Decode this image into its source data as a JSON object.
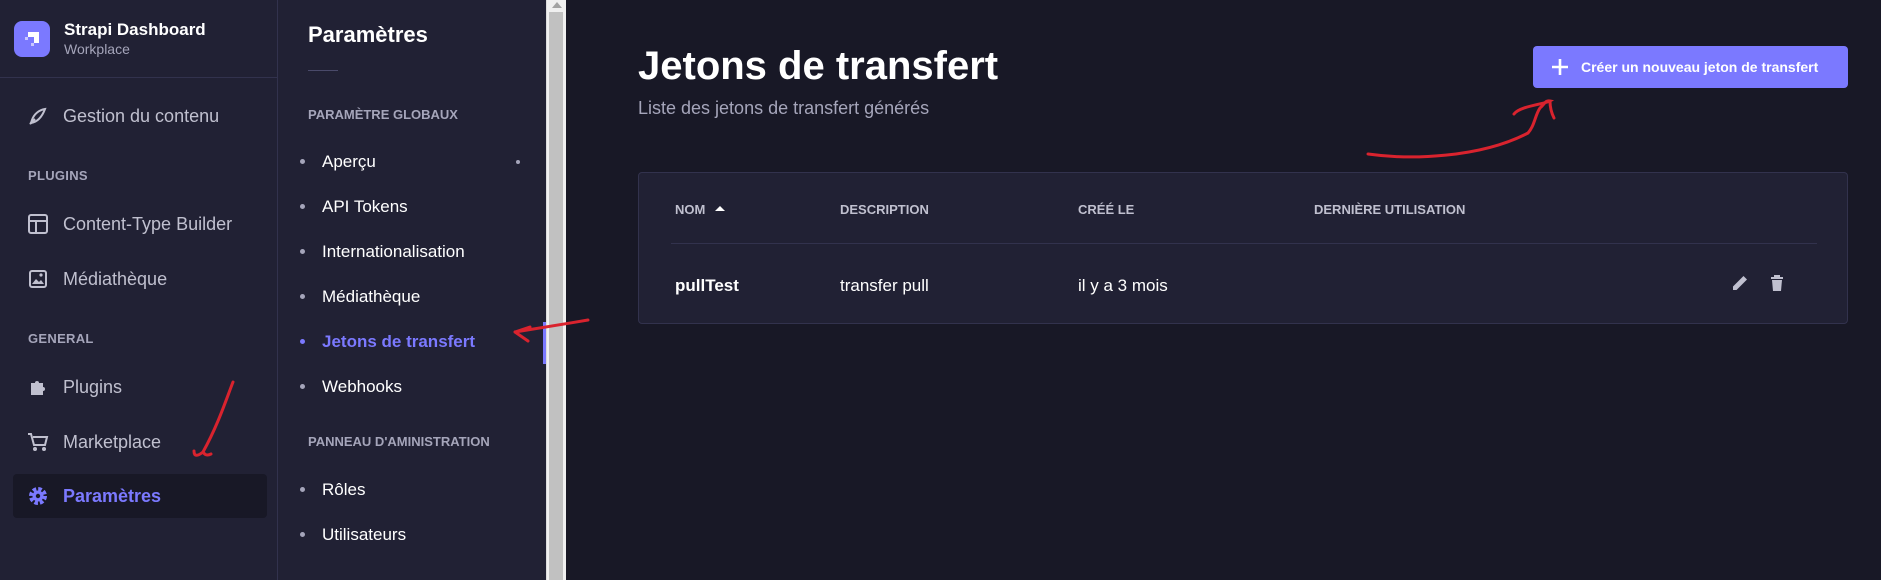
{
  "brand": {
    "title": "Strapi Dashboard",
    "subtitle": "Workplace"
  },
  "mainnav": {
    "content_manager": "Gestion du contenu",
    "plugins_section": "PLUGINS",
    "content_type_builder": "Content-Type Builder",
    "media_library": "Médiathèque",
    "general_section": "GENERAL",
    "plugins": "Plugins",
    "marketplace": "Marketplace",
    "settings": "Paramètres"
  },
  "subnav": {
    "title": "Paramètres",
    "global_section": "PARAMÈTRE GLOBAUX",
    "items": [
      {
        "label": "Aperçu"
      },
      {
        "label": "API Tokens"
      },
      {
        "label": "Internationalisation"
      },
      {
        "label": "Médiathèque"
      },
      {
        "label": "Jetons de transfert"
      },
      {
        "label": "Webhooks"
      }
    ],
    "admin_section": "PANNEAU D'AMINISTRATION",
    "admin_items": [
      {
        "label": "Rôles"
      },
      {
        "label": "Utilisateurs"
      }
    ]
  },
  "page": {
    "title": "Jetons de transfert",
    "subtitle": "Liste des jetons de transfert générés",
    "create_button": "Créer un nouveau jeton de transfert"
  },
  "table": {
    "headers": {
      "name": "NOM",
      "description": "DESCRIPTION",
      "created": "CRÉÉ LE",
      "last_used": "DERNIÈRE UTILISATION"
    },
    "rows": [
      {
        "name": "pullTest",
        "description": "transfer pull",
        "created": "il y a 3 mois",
        "last_used": ""
      }
    ]
  },
  "colors": {
    "accent": "#7b79ff",
    "background": "#181826",
    "panel": "#212134",
    "annotation": "#d9232e"
  }
}
